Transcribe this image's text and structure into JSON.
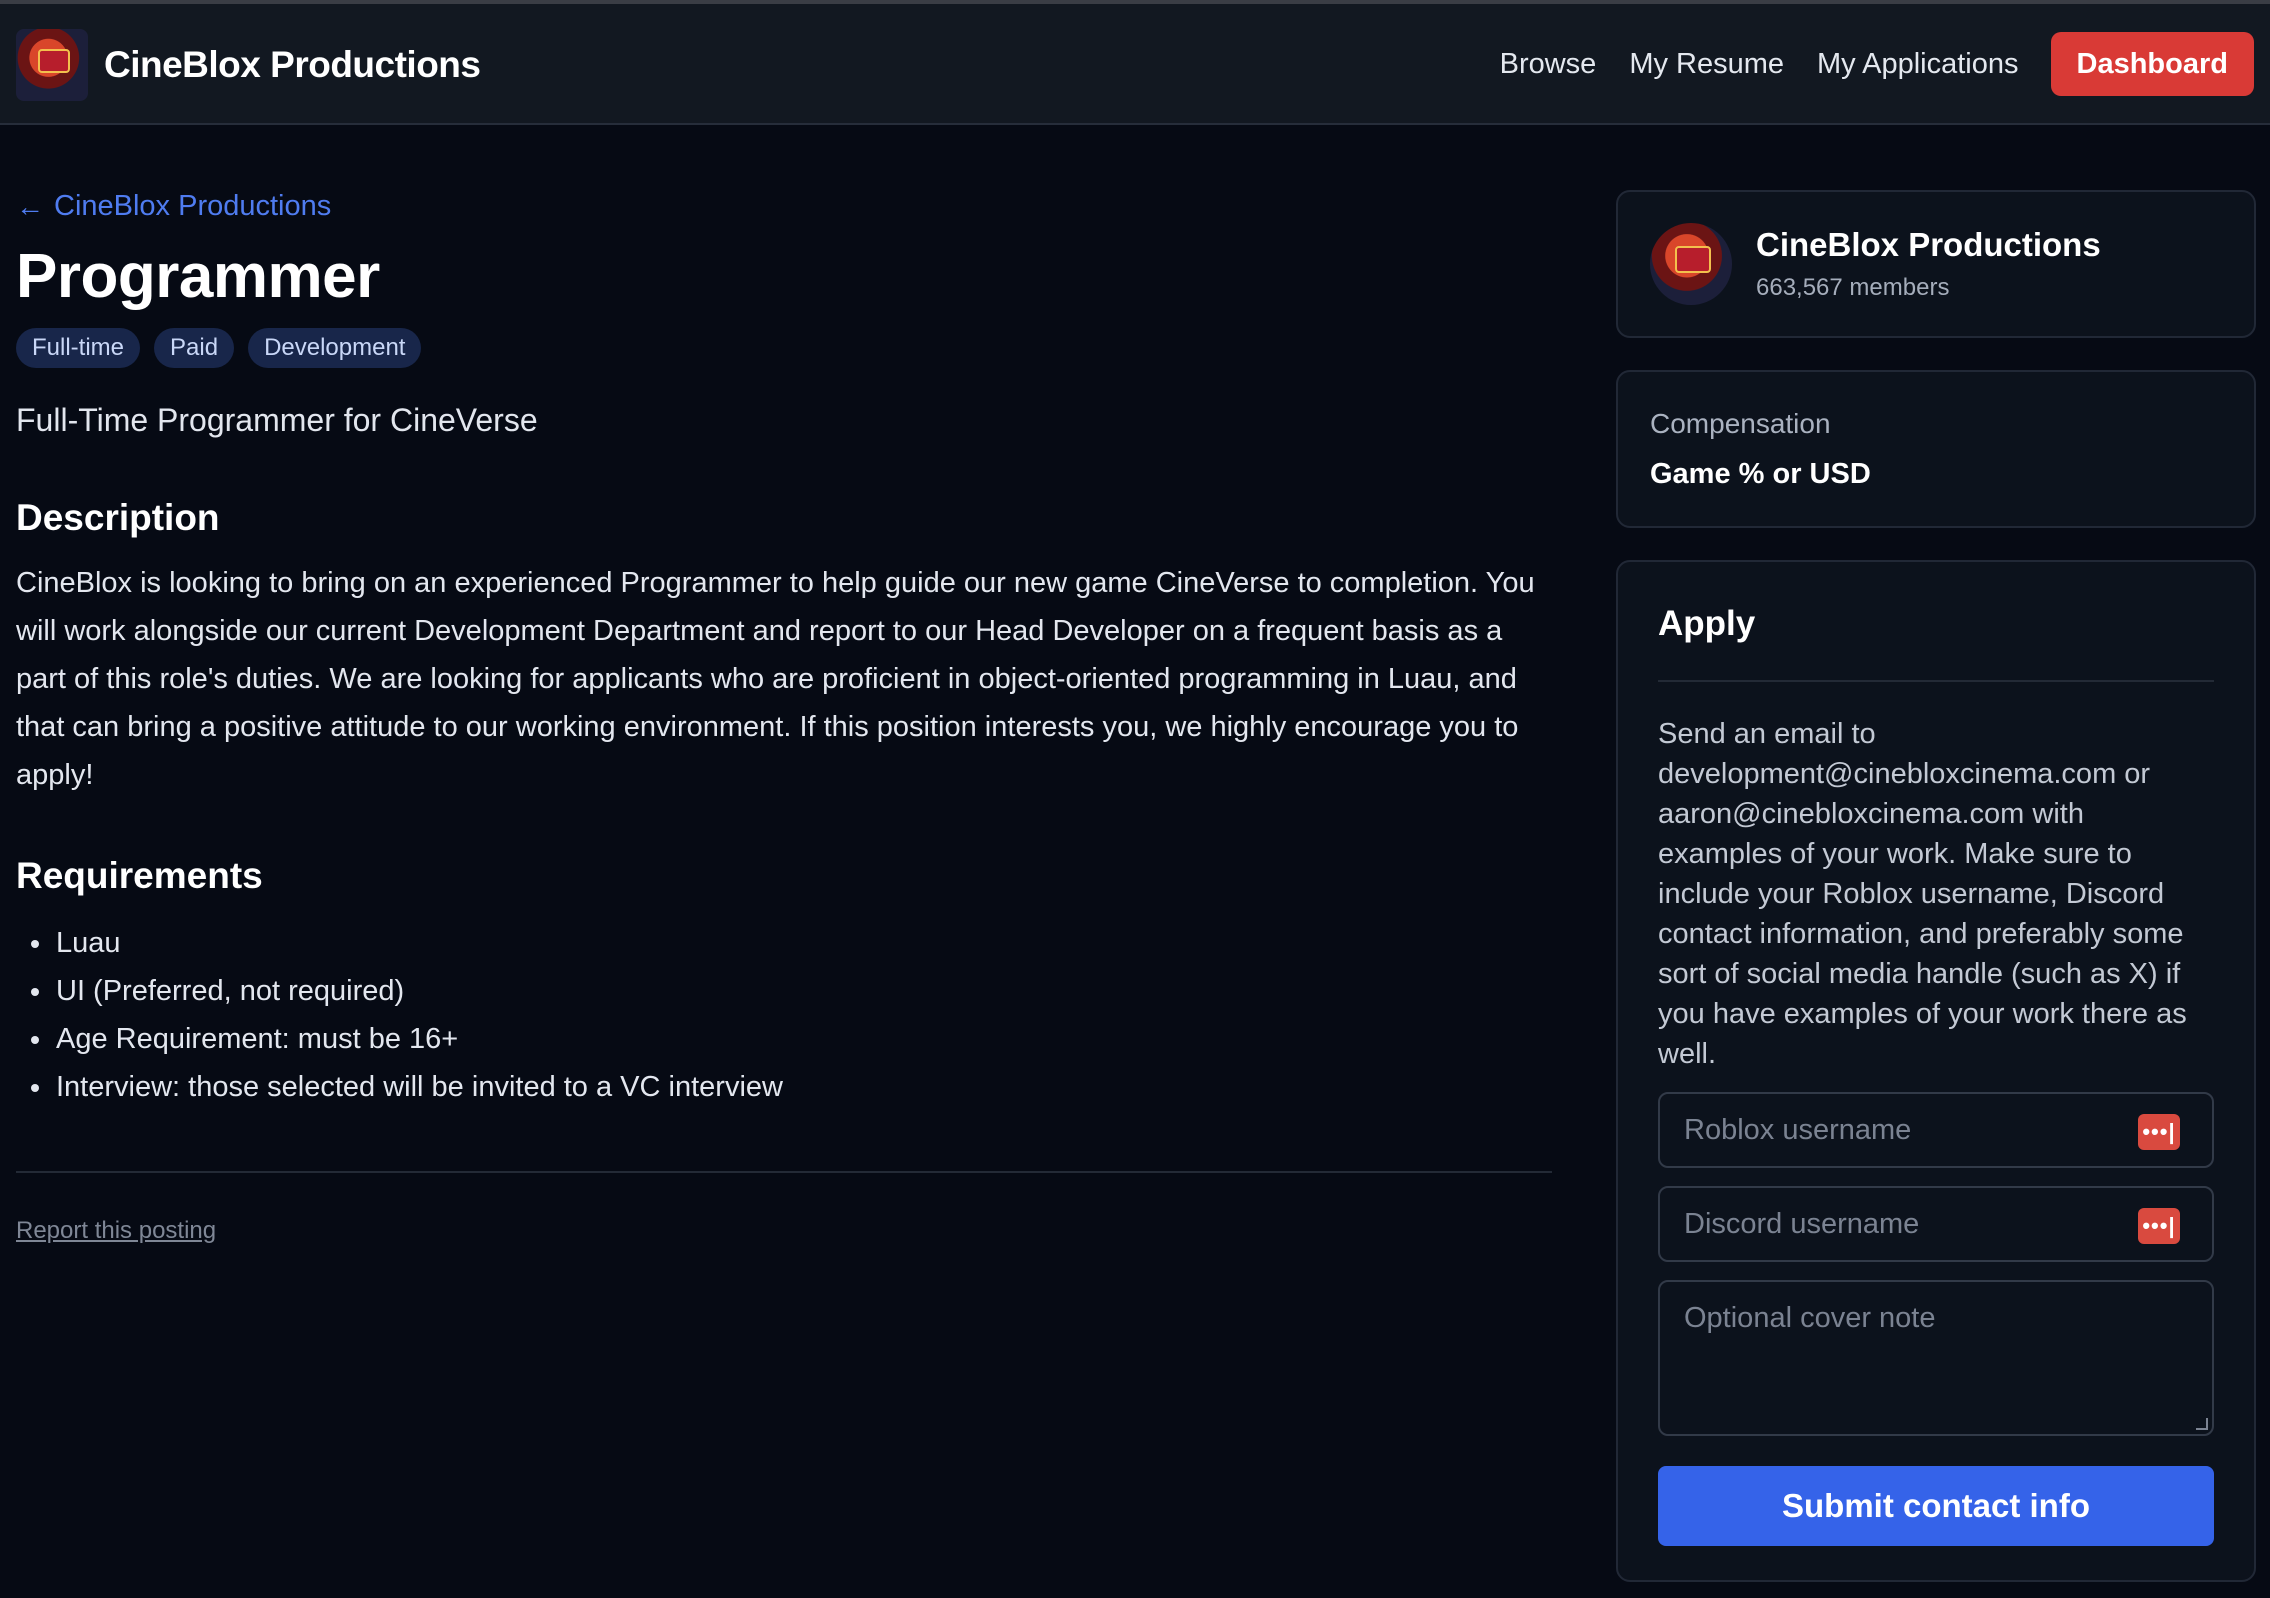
{
  "header": {
    "brand_name": "CineBlox Productions",
    "nav": {
      "browse": "Browse",
      "my_resume": "My Resume",
      "my_applications": "My Applications",
      "dashboard": "Dashboard"
    }
  },
  "main": {
    "back_link": "CineBlox Productions",
    "title": "Programmer",
    "tags": [
      "Full-time",
      "Paid",
      "Development"
    ],
    "subtitle": "Full-Time Programmer for CineVerse",
    "description_heading": "Description",
    "description": "CineBlox is looking to bring on an experienced Programmer to help guide our new game CineVerse to completion. You will work alongside our current Development Department and report to our Head Developer on a frequent basis as a part of this role's duties. We are looking for applicants who are proficient in object-oriented programming in Luau, and that can bring a positive attitude to our working environment. If this position interests you, we highly encourage you to apply!",
    "requirements_heading": "Requirements",
    "requirements": [
      "Luau",
      "UI (Preferred, not required)",
      "Age Requirement: must be 16+",
      "Interview: those selected will be invited to a VC interview"
    ],
    "report_link": "Report this posting"
  },
  "sidebar": {
    "org": {
      "name": "CineBlox Productions",
      "members": "663,567 members"
    },
    "compensation": {
      "label": "Compensation",
      "value": "Game % or USD"
    },
    "apply": {
      "title": "Apply",
      "instructions": "Send an email to development@cinebloxcinema.com or aaron@cinebloxcinema.com with examples of your work. Make sure to include your Roblox username, Discord contact information, and preferably some sort of social media handle (such as X) if you have examples of your work there as well.",
      "roblox_placeholder": "Roblox username",
      "roblox_value": "",
      "discord_placeholder": "Discord username",
      "discord_value": "",
      "note_placeholder": "Optional cover note",
      "note_value": "",
      "submit_label": "Submit contact info"
    }
  },
  "colors": {
    "accent_blue": "#3563e9",
    "link_blue": "#4f7cf0",
    "dashboard_red": "#d93a36",
    "background": "#060a14"
  },
  "icons": [
    "logo-image",
    "back-arrow-icon",
    "password-manager-icon"
  ]
}
